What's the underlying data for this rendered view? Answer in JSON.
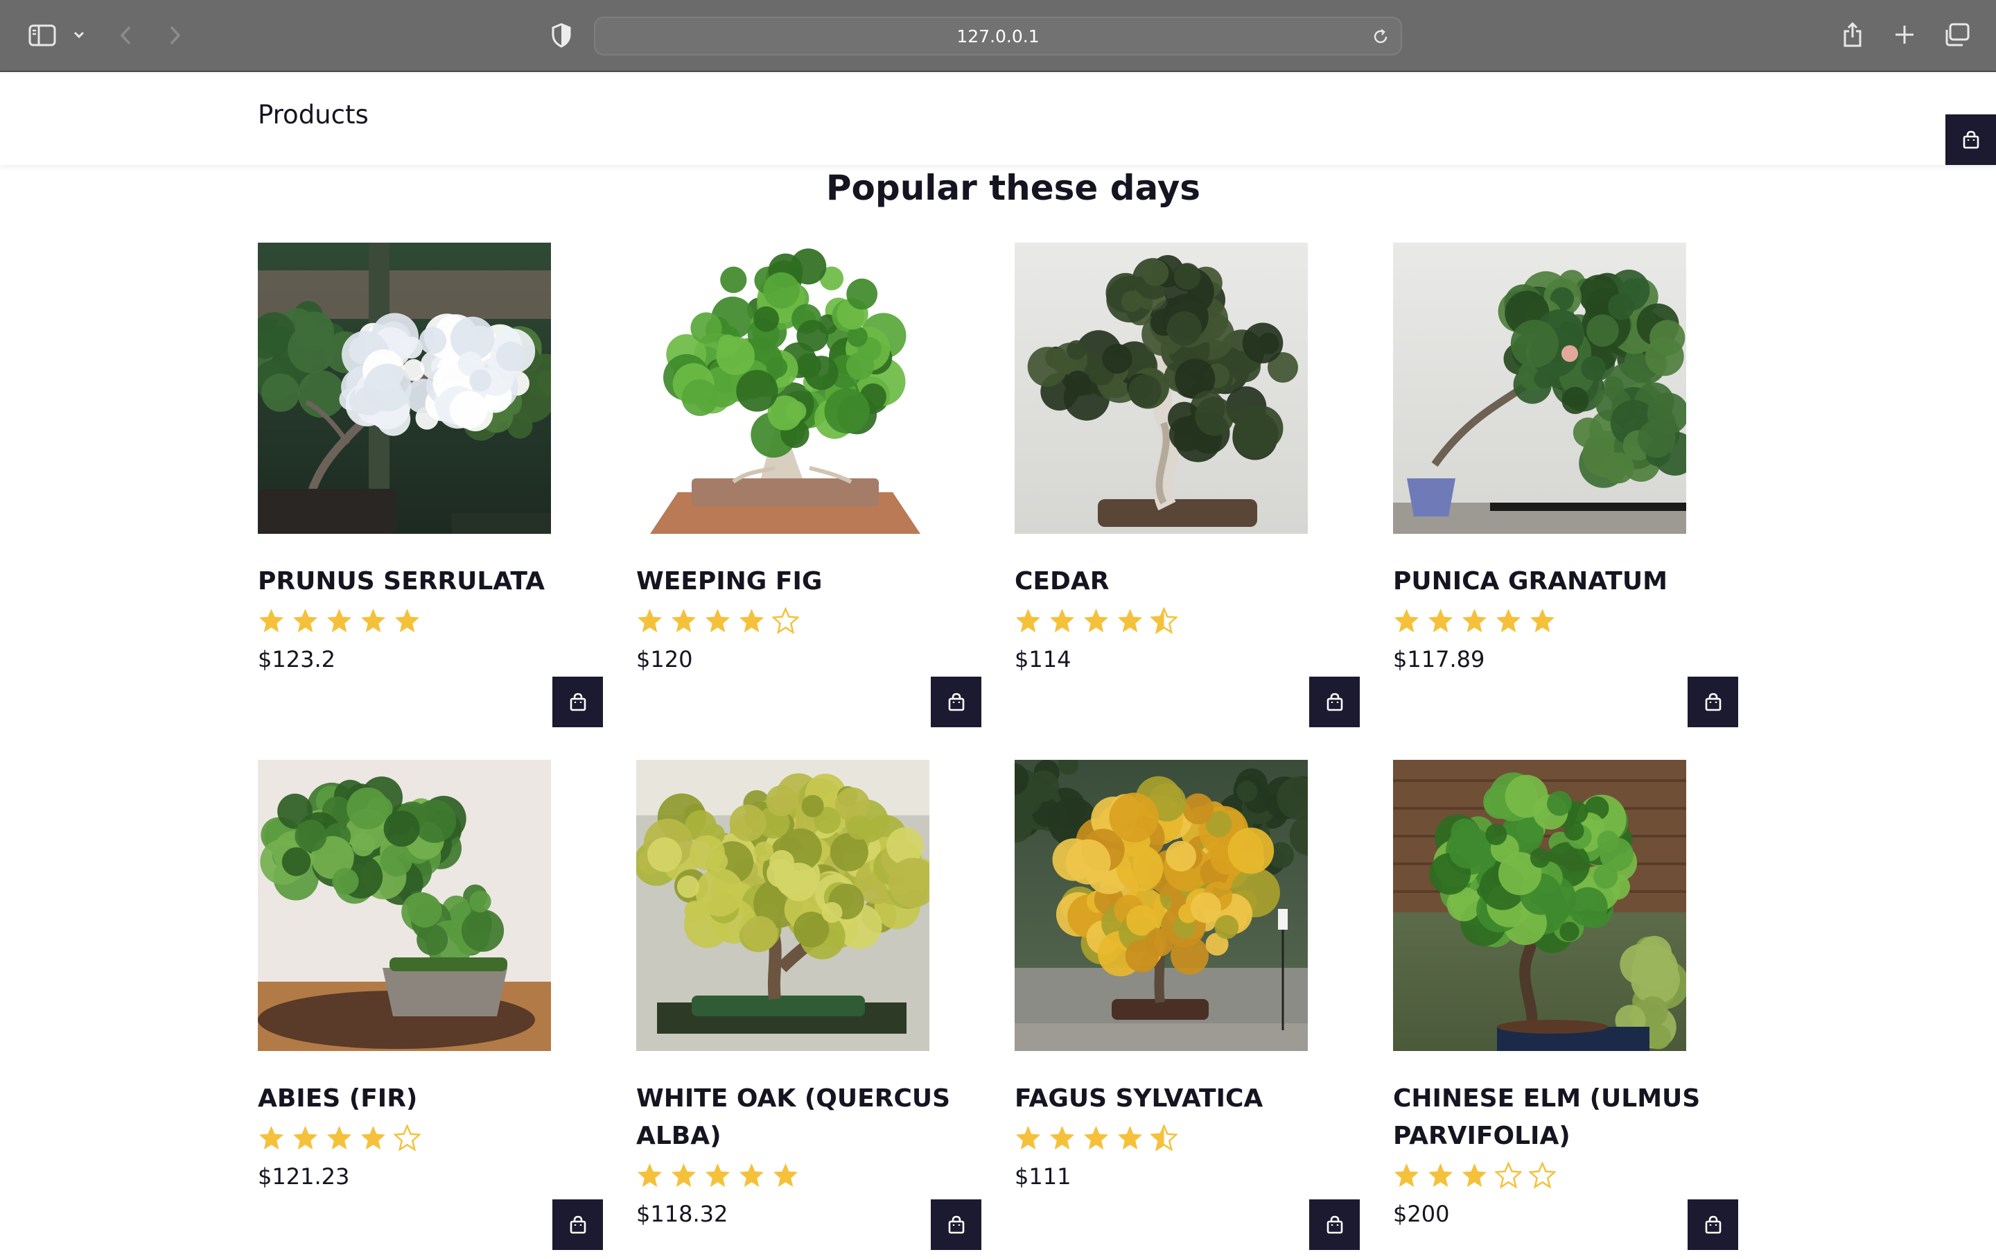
{
  "browser": {
    "url": "127.0.0.1",
    "sidebar_icon": "sidebar-icon",
    "back_icon": "chevron-left-icon",
    "forward_icon": "chevron-right-icon",
    "privacy_icon": "shield-icon",
    "reload_icon": "reload-icon",
    "share_icon": "share-icon",
    "new_tab_icon": "plus-icon",
    "tabs_icon": "tabs-overview-icon"
  },
  "header": {
    "nav_label": "Products",
    "cart_icon": "shopping-bag-icon"
  },
  "section": {
    "title": "Popular these days"
  },
  "colors": {
    "accent": "#1b1a30",
    "star": "#f5c13a",
    "text": "#151521"
  },
  "products": [
    {
      "name": "PRUNUS SERRULATA",
      "rating": 5,
      "price": "$123.2"
    },
    {
      "name": "WEEPING FIG",
      "rating": 4,
      "price": "$120"
    },
    {
      "name": "CEDAR",
      "rating": 4.5,
      "price": "$114"
    },
    {
      "name": "PUNICA GRANATUM",
      "rating": 5,
      "price": "$117.89"
    },
    {
      "name": "ABIES (FIR)",
      "rating": 4,
      "price": "$121.23"
    },
    {
      "name": "WHITE OAK (QUERCUS ALBA)",
      "rating": 5,
      "price": "$118.32"
    },
    {
      "name": "FAGUS SYLVATICA",
      "rating": 4.5,
      "price": "$111"
    },
    {
      "name": "CHINESE ELM (ULMUS PARVIFOLIA)",
      "rating": 3,
      "price": "$200"
    }
  ]
}
